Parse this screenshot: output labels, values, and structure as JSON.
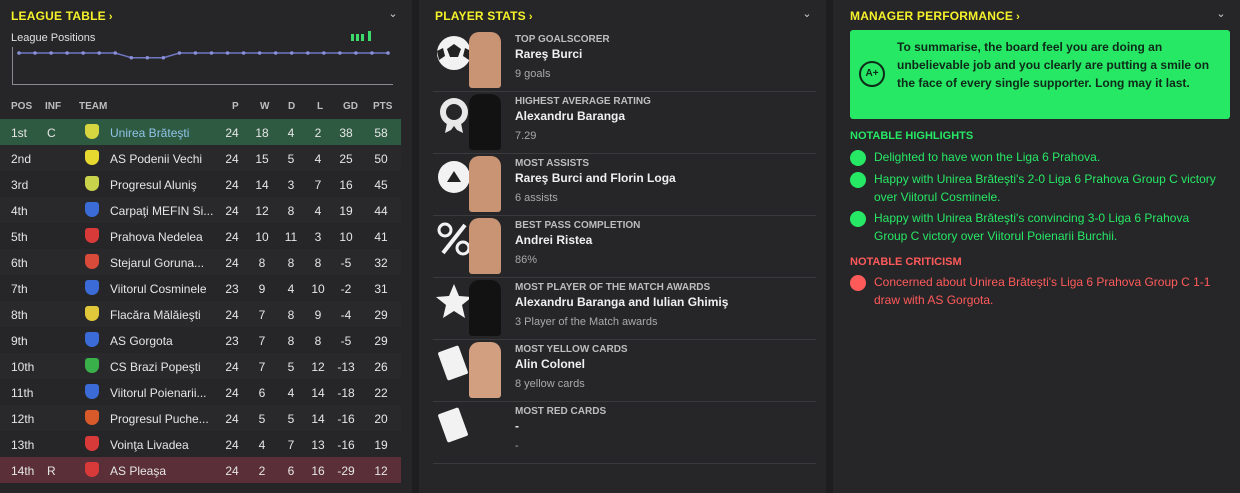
{
  "league": {
    "title": "LEAGUE TABLE",
    "positions_label": "League Positions",
    "columns": [
      "POS",
      "INF",
      "TEAM",
      "P",
      "W",
      "D",
      "L",
      "GD",
      "PTS"
    ],
    "rows": [
      {
        "pos": "1st",
        "inf": "C",
        "team": "Unirea Brăteşti",
        "p": "24",
        "w": "18",
        "d": "4",
        "l": "2",
        "gd": "38",
        "pts": "58",
        "crest": "#d8d640"
      },
      {
        "pos": "2nd",
        "inf": "",
        "team": "AS Podenii Vechi",
        "p": "24",
        "w": "15",
        "d": "5",
        "l": "4",
        "gd": "25",
        "pts": "50",
        "crest": "#e8d930"
      },
      {
        "pos": "3rd",
        "inf": "",
        "team": "Progresul Aluniş",
        "p": "24",
        "w": "14",
        "d": "3",
        "l": "7",
        "gd": "16",
        "pts": "45",
        "crest": "#c8d24a"
      },
      {
        "pos": "4th",
        "inf": "",
        "team": "Carpaţi MEFIN Si...",
        "p": "24",
        "w": "12",
        "d": "8",
        "l": "4",
        "gd": "19",
        "pts": "44",
        "crest": "#3a6bd6"
      },
      {
        "pos": "5th",
        "inf": "",
        "team": "Prahova Nedelea",
        "p": "24",
        "w": "10",
        "d": "11",
        "l": "3",
        "gd": "10",
        "pts": "41",
        "crest": "#d83a3a"
      },
      {
        "pos": "6th",
        "inf": "",
        "team": "Stejarul Goruna...",
        "p": "24",
        "w": "8",
        "d": "8",
        "l": "8",
        "gd": "-5",
        "pts": "32",
        "crest": "#d84a3a"
      },
      {
        "pos": "7th",
        "inf": "",
        "team": "Viitorul Cosminele",
        "p": "23",
        "w": "9",
        "d": "4",
        "l": "10",
        "gd": "-2",
        "pts": "31",
        "crest": "#3a6bd6"
      },
      {
        "pos": "8th",
        "inf": "",
        "team": "Flacăra Mălăieşti",
        "p": "24",
        "w": "7",
        "d": "8",
        "l": "9",
        "gd": "-4",
        "pts": "29",
        "crest": "#e0c83a"
      },
      {
        "pos": "9th",
        "inf": "",
        "team": "AS Gorgota",
        "p": "23",
        "w": "7",
        "d": "8",
        "l": "8",
        "gd": "-5",
        "pts": "29",
        "crest": "#3a6bd6"
      },
      {
        "pos": "10th",
        "inf": "",
        "team": "CS Brazi Popeşti",
        "p": "24",
        "w": "7",
        "d": "5",
        "l": "12",
        "gd": "-13",
        "pts": "26",
        "crest": "#3ab04a"
      },
      {
        "pos": "11th",
        "inf": "",
        "team": "Viitorul Poienarii...",
        "p": "24",
        "w": "6",
        "d": "4",
        "l": "14",
        "gd": "-18",
        "pts": "22",
        "crest": "#3a6bd6"
      },
      {
        "pos": "12th",
        "inf": "",
        "team": "Progresul Puche...",
        "p": "24",
        "w": "5",
        "d": "5",
        "l": "14",
        "gd": "-16",
        "pts": "20",
        "crest": "#d85a2a"
      },
      {
        "pos": "13th",
        "inf": "",
        "team": "Voinţa Livadea",
        "p": "24",
        "w": "4",
        "d": "7",
        "l": "13",
        "gd": "-16",
        "pts": "19",
        "crest": "#d83a3a"
      },
      {
        "pos": "14th",
        "inf": "R",
        "team": "AS Pleaşa",
        "p": "24",
        "w": "2",
        "d": "6",
        "l": "16",
        "gd": "-29",
        "pts": "12",
        "crest": "#d83a3a"
      }
    ],
    "position_history": [
      1,
      1,
      1,
      1,
      1,
      1,
      1,
      2,
      2,
      2,
      1,
      1,
      1,
      1,
      1,
      1,
      1,
      1,
      1,
      1,
      1,
      1,
      1,
      1
    ]
  },
  "stats": {
    "title": "PLAYER STATS",
    "items": [
      {
        "label": "TOP GOALSCORER",
        "name": "Rareş Burci",
        "sub": "9 goals",
        "icon": "football-icon",
        "face": "#c99474"
      },
      {
        "label": "HIGHEST AVERAGE RATING",
        "name": "Alexandru Baranga",
        "sub": "7.29",
        "icon": "rosette-icon",
        "face": "#121212"
      },
      {
        "label": "MOST ASSISTS",
        "name": "Rareş Burci and Florin Loga",
        "sub": "6 assists",
        "icon": "assist-icon",
        "face": "#c99474"
      },
      {
        "label": "BEST PASS COMPLETION",
        "name": "Andrei Ristea",
        "sub": "86%",
        "icon": "percent-icon",
        "face": "#c99474"
      },
      {
        "label": "MOST PLAYER OF THE MATCH AWARDS",
        "name": "Alexandru Baranga and Iulian Ghimiş",
        "sub": "3 Player of the Match awards",
        "icon": "star-icon",
        "face": "#121212"
      },
      {
        "label": "MOST YELLOW CARDS",
        "name": "Alin Colonel",
        "sub": "8 yellow cards",
        "icon": "yellow-card-icon",
        "face": "#d2a080"
      },
      {
        "label": "MOST RED CARDS",
        "name": "-",
        "sub": "-",
        "icon": "red-card-icon",
        "face": ""
      }
    ]
  },
  "manager": {
    "title": "MANAGER PERFORMANCE",
    "grade": "A+",
    "summary": "To summarise, the board feel you are doing an unbelievable job and you clearly are putting a smile on the face of every single supporter. Long may it last.",
    "highlights_title": "NOTABLE HIGHLIGHTS",
    "highlights": [
      "Delighted to have won the Liga 6 Prahova.",
      "Happy with Unirea Brăteşti's 2-0 Liga 6 Prahova Group C victory over Viitorul Cosminele.",
      "Happy with Unirea Brăteşti's convincing 3-0 Liga 6 Prahova Group C victory over Viitorul Poienarii Burchii."
    ],
    "criticism_title": "NOTABLE CRITICISM",
    "criticism": [
      "Concerned about Unirea Brăteşti's Liga 6 Prahova Group C 1-1 draw with AS Gorgota."
    ]
  },
  "colors": {
    "accent": "#f5f12a",
    "positive": "#26e865",
    "negative": "#ff5a5a",
    "panel": "#262629"
  }
}
